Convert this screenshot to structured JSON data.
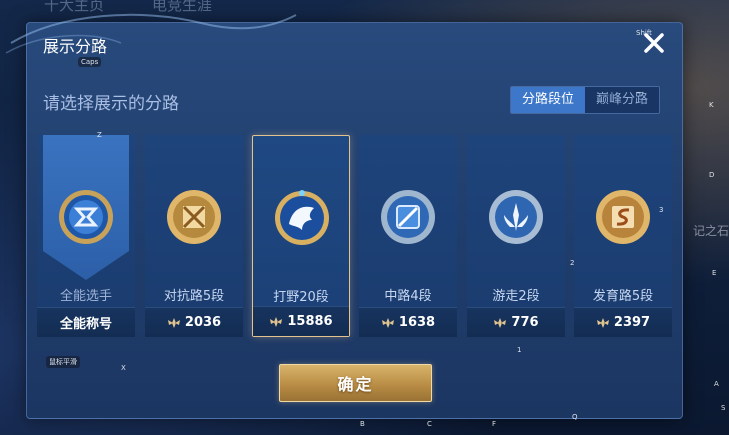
{
  "background": {
    "tabs": [
      "十大主页",
      "电竞生涯"
    ],
    "side_text": "记之石"
  },
  "modal": {
    "title": "展示分路",
    "close_icon": "close-icon",
    "prompt": "请选择展示的分路",
    "segments": [
      {
        "label": "分路段位",
        "active": true
      },
      {
        "label": "巅峰分路",
        "active": false
      }
    ],
    "cards": [
      {
        "role": "全能选手",
        "stat": "全能称号",
        "emblem": "all-round-emblem-icon",
        "selected": false
      },
      {
        "role": "对抗路5段",
        "stat": "2036",
        "emblem": "clash-lane-emblem-icon",
        "selected": false
      },
      {
        "role": "打野20段",
        "stat": "15886",
        "emblem": "jungle-emblem-icon",
        "selected": true
      },
      {
        "role": "中路4段",
        "stat": "1638",
        "emblem": "mid-lane-emblem-icon",
        "selected": false
      },
      {
        "role": "游走2段",
        "stat": "776",
        "emblem": "roam-emblem-icon",
        "selected": false
      },
      {
        "role": "发育路5段",
        "stat": "2397",
        "emblem": "farm-lane-emblem-icon",
        "selected": false
      }
    ],
    "confirm_label": "确定"
  },
  "hotkeys": {
    "shift": "Shift",
    "caps": "Caps",
    "z": "Z",
    "x": "X",
    "a": "A",
    "s": "S",
    "d": "D",
    "e": "E",
    "k": "K",
    "b": "B",
    "c": "C",
    "f": "F",
    "q": "Q",
    "one": "1",
    "two": "2",
    "three": "3",
    "dash": "一",
    "feature": "鼠标平滑"
  },
  "colors": {
    "accent_gold": "#d9b46b",
    "active_segment": "#3d77c9",
    "panel": "#244577"
  }
}
